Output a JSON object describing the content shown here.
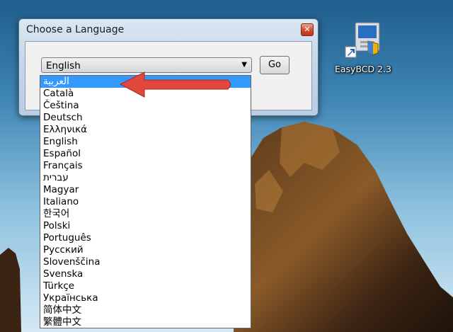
{
  "window": {
    "title": "Choose a Language",
    "close_glyph": "✕",
    "combo": {
      "selected": "English",
      "arrow_glyph": "▼"
    },
    "go_label": "Go"
  },
  "dropdown": {
    "options": [
      "العربية",
      "Català",
      "Čeština",
      "Deutsch",
      "Ελληνικά",
      "English",
      "Español",
      "Français",
      "עברית",
      "Magyar",
      "Italiano",
      "한국어",
      "Polski",
      "Português",
      "Русский",
      "Slovenščina",
      "Svenska",
      "Türkçe",
      "Українська",
      "简体中文",
      "繁體中文"
    ],
    "highlighted_index": 0
  },
  "desktop": {
    "shortcut_label": "EasyBCD 2.3"
  },
  "colors": {
    "highlight": "#3399ff",
    "annotation_arrow": "#e0473d"
  }
}
